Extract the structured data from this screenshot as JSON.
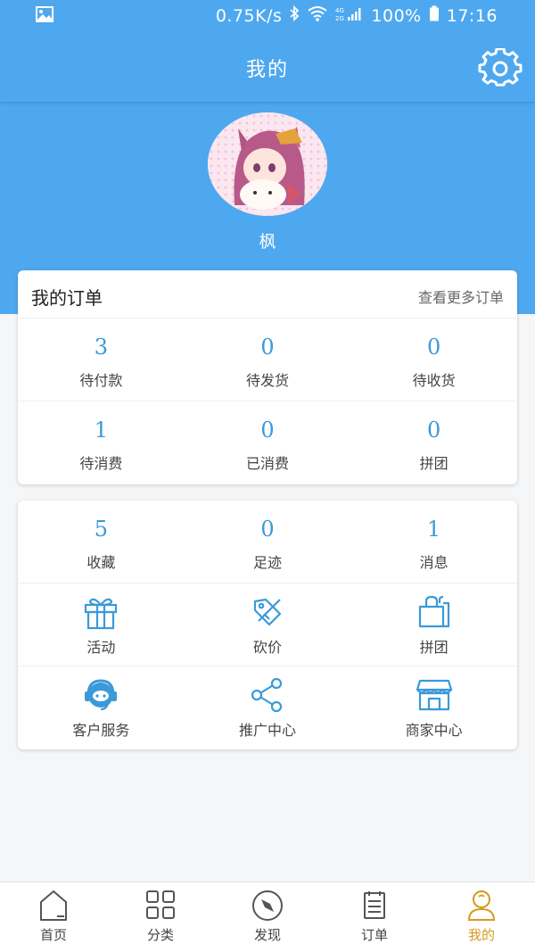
{
  "status_bar": {
    "speed": "0.75K/s",
    "network": "4G 2G",
    "battery": "100%",
    "time": "17:16"
  },
  "header": {
    "title": "我的",
    "settings_icon": "gear-icon"
  },
  "profile": {
    "nickname": "枫"
  },
  "orders": {
    "title": "我的订单",
    "more_label": "查看更多订单",
    "items": [
      {
        "count": "3",
        "label": "待付款"
      },
      {
        "count": "0",
        "label": "待发货"
      },
      {
        "count": "0",
        "label": "待收货"
      },
      {
        "count": "1",
        "label": "待消费"
      },
      {
        "count": "0",
        "label": "已消费"
      },
      {
        "count": "0",
        "label": "拼团"
      }
    ]
  },
  "stats": [
    {
      "count": "5",
      "label": "收藏"
    },
    {
      "count": "0",
      "label": "足迹"
    },
    {
      "count": "1",
      "label": "消息"
    }
  ],
  "services": [
    {
      "icon": "gift-icon",
      "label": "活动"
    },
    {
      "icon": "price-tag-icon",
      "label": "砍价"
    },
    {
      "icon": "shopping-bag-icon",
      "label": "拼团"
    },
    {
      "icon": "headset-icon",
      "label": "客户服务"
    },
    {
      "icon": "share-icon",
      "label": "推广中心"
    },
    {
      "icon": "store-icon",
      "label": "商家中心"
    }
  ],
  "bottom_nav": [
    {
      "icon": "home-icon",
      "label": "首页"
    },
    {
      "icon": "category-grid-icon",
      "label": "分类"
    },
    {
      "icon": "compass-icon",
      "label": "发现"
    },
    {
      "icon": "clipboard-icon",
      "label": "订单"
    },
    {
      "icon": "user-icon",
      "label": "我的",
      "active": true
    }
  ],
  "colors": {
    "primary": "#4ea8ef",
    "count_text": "#3a9ad9",
    "icon": "#3a9ad9",
    "active_tab": "#d79a1f",
    "background": "#f5f6f8"
  }
}
